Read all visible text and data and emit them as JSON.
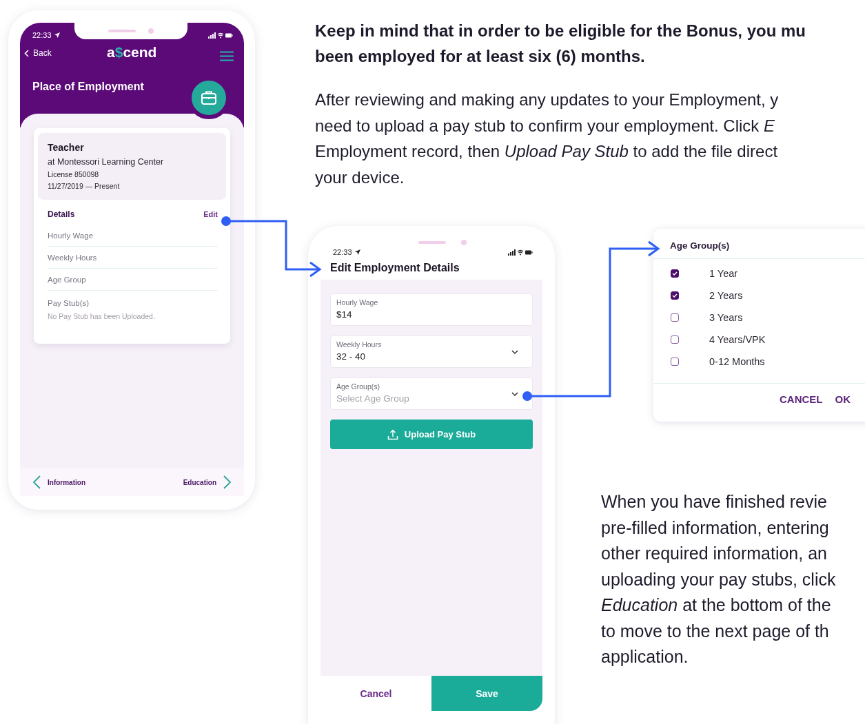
{
  "intro": {
    "bold_lines": [
      "Keep in mind that in order to be eligible for the Bonus, you mu",
      "been employed for at least six (6) months."
    ],
    "lines": [
      "After reviewing and making any updates to your Employment, y",
      "need to upload a pay stub to confirm your employment. Click *E*",
      "Employment record, then *Upload Pay Stub* to add the file direct",
      "your device."
    ]
  },
  "employment_screen": {
    "status_time": "22:33",
    "back": "Back",
    "logo": "a$cend",
    "title": "Place of Employment",
    "job": {
      "title": "Teacher",
      "employer": "at Montessori Learning Center",
      "license": "License 850098",
      "dates": "11/27/2019 — Present"
    },
    "details": {
      "heading": "Details",
      "edit": "Edit",
      "fields": [
        "Hourly Wage",
        "Weekly Hours",
        "Age Group"
      ],
      "pay_stub": {
        "label": "Pay Stub(s)",
        "note": "No Pay Stub has been Uploaded."
      }
    },
    "nav": {
      "previous": "Information",
      "next": "Education"
    }
  },
  "edit_screen": {
    "status_time": "22:33",
    "title": "Edit Employment Details",
    "fields": [
      {
        "label": "Hourly Wage",
        "value": "$14",
        "kind": "text"
      },
      {
        "label": "Weekly Hours",
        "value": "32 - 40",
        "kind": "select"
      },
      {
        "label": "Age Group(s)",
        "placeholder": "Select Age Group",
        "kind": "select"
      }
    ],
    "upload_button": "Upload Pay Stub",
    "cancel": "Cancel",
    "save": "Save"
  },
  "age_dialog": {
    "title": "Age Group(s)",
    "options": [
      {
        "label": "1 Year",
        "checked": true
      },
      {
        "label": "2 Years",
        "checked": true
      },
      {
        "label": "3 Years",
        "checked": false
      },
      {
        "label": "4 Years/VPK",
        "checked": false
      },
      {
        "label": "0-12 Months",
        "checked": false
      }
    ],
    "buttons": [
      "CANCEL",
      "OK"
    ]
  },
  "summary": {
    "lines": [
      "When you have finished revie",
      "pre-filled information, entering",
      "other required information, an",
      "uploading your pay stubs, click",
      "*Education* at the bottom of the",
      "to move to the next page of th",
      "application."
    ]
  }
}
